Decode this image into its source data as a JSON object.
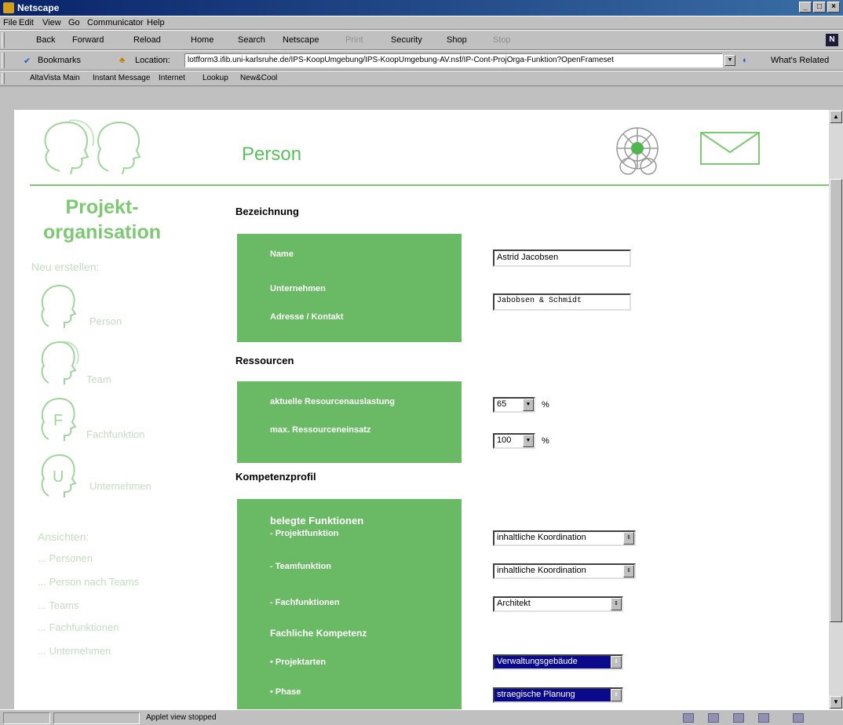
{
  "window": {
    "title": "Netscape"
  },
  "menu": [
    "File",
    "Edit",
    "View",
    "Go",
    "Communicator",
    "Help"
  ],
  "nav": {
    "back": "Back",
    "forward": "Forward",
    "reload": "Reload",
    "home": "Home",
    "search": "Search",
    "netscape": "Netscape",
    "print": "Print",
    "security": "Security",
    "shop": "Shop",
    "stop": "Stop"
  },
  "location": {
    "bookmarks": "Bookmarks",
    "label": "Location:",
    "url": "lotfform3.ifib.uni-karlsruhe.de/IPS-KoopUmgebung/IPS-KoopUmgebung-AV.nsf/IP-Cont-ProjOrga-Funktion?OpenFrameset",
    "related": "What's Related"
  },
  "personal_toolbar": [
    "AltaVista Main",
    "Instant Message",
    "Internet",
    "Lookup",
    "New&Cool"
  ],
  "page": {
    "title": "Person",
    "sidebar": {
      "heading_1": "Projekt-",
      "heading_2": "organisation",
      "new_label": "Neu erstellen:",
      "create_items": [
        "Person",
        "Team",
        "Fachfunktion",
        "Unternehmen"
      ],
      "views_label": "Ansichten:",
      "view_links": [
        "... Personen",
        "... Person nach Teams",
        "... Teams",
        "... Fachfunktionen",
        "... Unternehmen"
      ]
    },
    "sections": {
      "bezeichnung": "Bezeichnung",
      "ressourcen": "Ressourcen",
      "kompetenz": "Kompetenzprofil"
    },
    "bez": {
      "name_label": "Name",
      "company_label": "Unternehmen",
      "address_label": "Adresse / Kontakt",
      "name_value": "Astrid Jacobsen",
      "company_value": "Jabobsen & Schmidt"
    },
    "res": {
      "current_label": "aktuelle Resourcenauslastung",
      "max_label": "max. Ressourceneinsatz",
      "current_value": "65",
      "max_value": "100",
      "unit": "%"
    },
    "komp": {
      "functions_label": "belegte Funktionen",
      "project_fn_label": "- Projektfunktion",
      "team_fn_label": "- Teamfunktion",
      "fach_fn_label": "- Fachfunktionen",
      "fach_komp_label": "Fachliche Kompetenz",
      "project_types_label": "• Projektarten",
      "phase_label": "• Phase",
      "project_fn_value": "inhaltliche Koordination",
      "team_fn_value": "inhaltliche Koordination",
      "fach_fn_value": "Architekt",
      "project_types_value": "Verwaltungsgebäude",
      "phase_value": "straegische Planung"
    }
  },
  "status": {
    "text": "Applet view stopped"
  }
}
